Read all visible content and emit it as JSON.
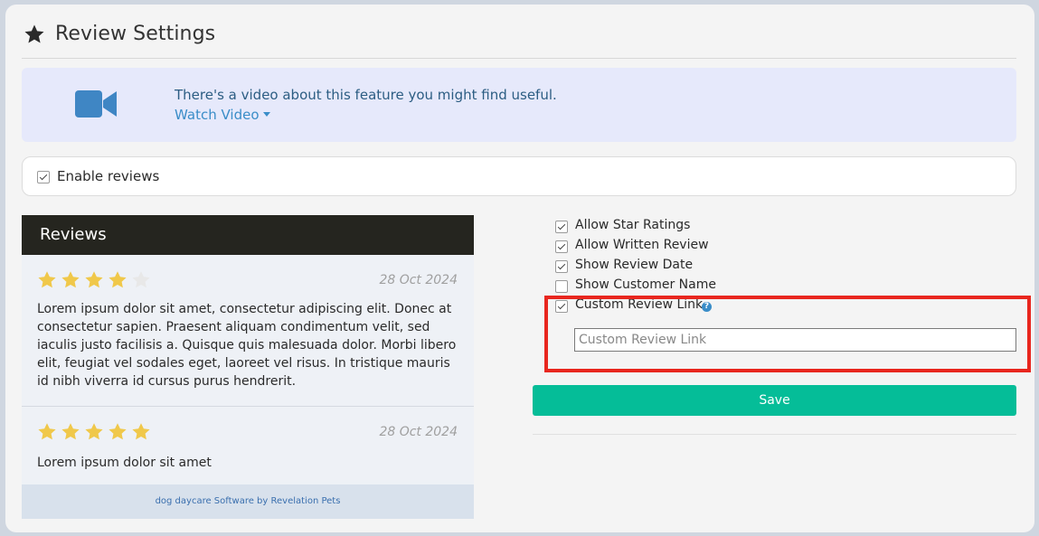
{
  "page": {
    "title": "Review Settings"
  },
  "video_banner": {
    "text": "There's a video about this feature you might find useful.",
    "link_label": "Watch Video"
  },
  "enable_reviews": {
    "label": "Enable reviews",
    "checked": true
  },
  "reviews_panel": {
    "title": "Reviews",
    "reviews": [
      {
        "rating": 4,
        "max_rating": 5,
        "date": "28 Oct 2024",
        "text": "Lorem ipsum dolor sit amet, consectetur adipiscing elit. Donec at consectetur sapien. Praesent aliquam condimentum velit, sed iaculis justo facilisis a. Quisque quis malesuada dolor. Morbi libero elit, feugiat vel sodales eget, laoreet vel risus. In tristique mauris id nibh viverra id cursus purus hendrerit."
      },
      {
        "rating": 5,
        "max_rating": 5,
        "date": "28 Oct 2024",
        "text": "Lorem ipsum dolor sit amet"
      }
    ],
    "footer": "dog daycare Software by Revelation Pets"
  },
  "options": [
    {
      "label": "Allow Star Ratings",
      "checked": true
    },
    {
      "label": "Allow Written Review",
      "checked": true
    },
    {
      "label": "Show Review Date",
      "checked": true
    },
    {
      "label": "Show Customer Name",
      "checked": false
    },
    {
      "label": "Custom Review Link",
      "checked": true
    }
  ],
  "custom_link": {
    "placeholder": "Custom Review Link",
    "value": ""
  },
  "save_label": "Save",
  "colors": {
    "accent_green": "#05bd98",
    "star_filled": "#f0c84a",
    "star_empty": "#e8e8e8",
    "highlight_red": "#e8261e",
    "link_blue": "#3a8dc8",
    "header_dark": "#25251f"
  }
}
